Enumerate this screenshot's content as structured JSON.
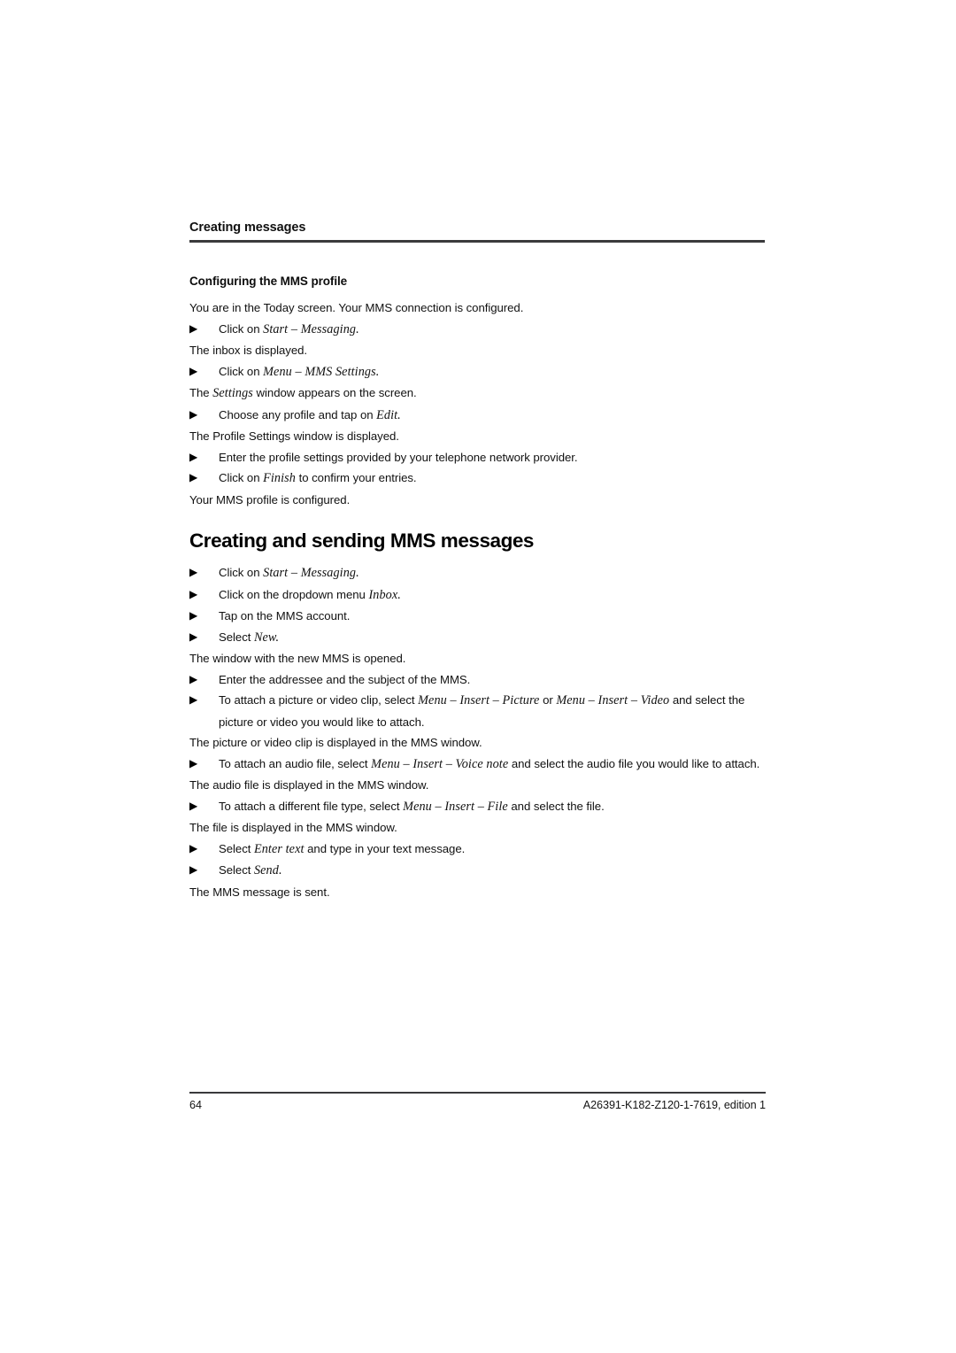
{
  "header": {
    "running_title": "Creating messages"
  },
  "sections": [
    {
      "subheading": "Configuring the MMS profile",
      "intro": "You are in the Today screen. Your MMS connection is configured.",
      "blocks": [
        {
          "kind": "step",
          "segments": [
            {
              "t": "Click on ",
              "i": false
            },
            {
              "t": "Start – Messaging.",
              "i": true
            }
          ]
        },
        {
          "kind": "para",
          "segments": [
            {
              "t": "The inbox is displayed.",
              "i": false
            }
          ]
        },
        {
          "kind": "step",
          "segments": [
            {
              "t": "Click on ",
              "i": false
            },
            {
              "t": "Menu – MMS Settings.",
              "i": true
            }
          ]
        },
        {
          "kind": "para",
          "segments": [
            {
              "t": "The ",
              "i": false
            },
            {
              "t": "Settings",
              "i": true
            },
            {
              "t": " window appears on the screen.",
              "i": false
            }
          ]
        },
        {
          "kind": "step",
          "segments": [
            {
              "t": "Choose any profile and tap on ",
              "i": false
            },
            {
              "t": "Edit.",
              "i": true
            }
          ]
        },
        {
          "kind": "para",
          "segments": [
            {
              "t": "The Profile Settings window is displayed.",
              "i": false
            }
          ]
        },
        {
          "kind": "step",
          "segments": [
            {
              "t": "Enter the profile settings provided by your telephone network provider.",
              "i": false
            }
          ]
        },
        {
          "kind": "step",
          "segments": [
            {
              "t": "Click on ",
              "i": false
            },
            {
              "t": "Finish",
              "i": true
            },
            {
              "t": " to confirm your entries.",
              "i": false
            }
          ]
        },
        {
          "kind": "para",
          "segments": [
            {
              "t": "Your MMS profile is configured.",
              "i": false
            }
          ]
        }
      ]
    },
    {
      "heading": "Creating and sending MMS messages",
      "blocks": [
        {
          "kind": "step",
          "segments": [
            {
              "t": "Click on ",
              "i": false
            },
            {
              "t": "Start – Messaging.",
              "i": true
            }
          ]
        },
        {
          "kind": "step",
          "segments": [
            {
              "t": "Click on the dropdown menu ",
              "i": false
            },
            {
              "t": "Inbox.",
              "i": true
            }
          ]
        },
        {
          "kind": "step",
          "segments": [
            {
              "t": "Tap on the MMS account.",
              "i": false
            }
          ]
        },
        {
          "kind": "step",
          "segments": [
            {
              "t": "Select ",
              "i": false
            },
            {
              "t": "New.",
              "i": true
            }
          ]
        },
        {
          "kind": "para",
          "segments": [
            {
              "t": "The window with the new MMS is opened.",
              "i": false
            }
          ]
        },
        {
          "kind": "step",
          "segments": [
            {
              "t": "Enter the addressee and the subject of the MMS.",
              "i": false
            }
          ]
        },
        {
          "kind": "step",
          "segments": [
            {
              "t": "To attach a picture or video clip, select ",
              "i": false
            },
            {
              "t": "Menu – Insert – Picture",
              "i": true
            },
            {
              "t": " or ",
              "i": false
            },
            {
              "t": "Menu – Insert – Video",
              "i": true
            },
            {
              "t": " and select the picture or video you would like to attach.",
              "i": false
            }
          ]
        },
        {
          "kind": "para",
          "segments": [
            {
              "t": "The picture or video clip is displayed in the MMS window.",
              "i": false
            }
          ]
        },
        {
          "kind": "step",
          "segments": [
            {
              "t": "To attach an audio file, select ",
              "i": false
            },
            {
              "t": "Menu – Insert – Voice note",
              "i": true
            },
            {
              "t": " and select the audio file you would like to attach.",
              "i": false
            }
          ]
        },
        {
          "kind": "para",
          "segments": [
            {
              "t": "The audio file is displayed in the MMS window.",
              "i": false
            }
          ]
        },
        {
          "kind": "step",
          "segments": [
            {
              "t": "To attach a different file type, select ",
              "i": false
            },
            {
              "t": "Menu – Insert – File",
              "i": true
            },
            {
              "t": " and select the file.",
              "i": false
            }
          ]
        },
        {
          "kind": "para",
          "segments": [
            {
              "t": "The file is displayed in the MMS window.",
              "i": false
            }
          ]
        },
        {
          "kind": "step",
          "segments": [
            {
              "t": "Select ",
              "i": false
            },
            {
              "t": "Enter text",
              "i": true
            },
            {
              "t": " and type in your text message.",
              "i": false
            }
          ]
        },
        {
          "kind": "step",
          "segments": [
            {
              "t": "Select ",
              "i": false
            },
            {
              "t": "Send.",
              "i": true
            }
          ]
        },
        {
          "kind": "para",
          "segments": [
            {
              "t": "The MMS message is sent.",
              "i": false
            }
          ]
        }
      ]
    }
  ],
  "footer": {
    "page_number": "64",
    "document_id": "A26391-K182-Z120-1-7619, edition 1"
  },
  "icons": {
    "bullet": "▶"
  },
  "colors": {
    "rule": "#3a3a3c",
    "text": "#111111",
    "background": "#ffffff"
  }
}
